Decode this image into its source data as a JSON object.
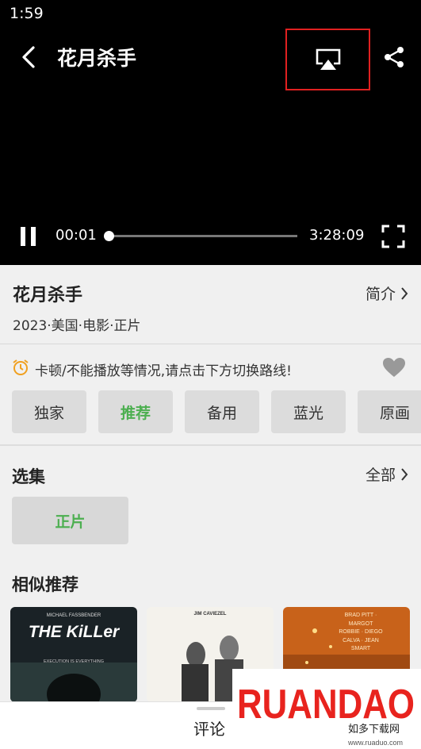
{
  "status_bar": {
    "time": "1:59"
  },
  "player": {
    "title": "花月杀手",
    "current_time": "00:01",
    "duration": "3:28:09",
    "progress": 0.0
  },
  "info": {
    "title": "花月杀手",
    "intro_label": "简介",
    "meta": "2023·美国·电影·正片"
  },
  "notice": {
    "text": "卡顿/不能播放等情况,请点击下方切换路线!"
  },
  "routes": [
    {
      "label": "独家",
      "active": false
    },
    {
      "label": "推荐",
      "active": true
    },
    {
      "label": "备用",
      "active": false
    },
    {
      "label": "蓝光",
      "active": false
    },
    {
      "label": "原画",
      "active": false
    }
  ],
  "episodes": {
    "heading": "选集",
    "all_label": "全部",
    "items": [
      {
        "label": "正片"
      }
    ]
  },
  "similar": {
    "heading": "相似推荐",
    "posters": [
      {
        "credit": "MICHAEL FASSBENDER",
        "title": "THE KiLLer",
        "tagline": "EXECUTION IS EVERYTHING"
      },
      {
        "credit": "JIM CAVIEZEL"
      },
      {
        "credit": "BRAD PITT · MARGOT ROBBIE · DIEGO CALVA · JEAN SMART"
      }
    ]
  },
  "bottom_bar": {
    "comment_label": "评论"
  },
  "watermark": {
    "brand": "RUANDAO",
    "sub": "如多下载网",
    "url": "www.ruaduo.com"
  },
  "colors": {
    "accent_green": "#4caf50",
    "highlight_red": "#e02020"
  },
  "icons": [
    "back-arrow-icon",
    "cast-icon",
    "share-icon",
    "pause-icon",
    "fullscreen-icon",
    "chevron-right-icon",
    "alarm-clock-icon",
    "heart-icon"
  ]
}
